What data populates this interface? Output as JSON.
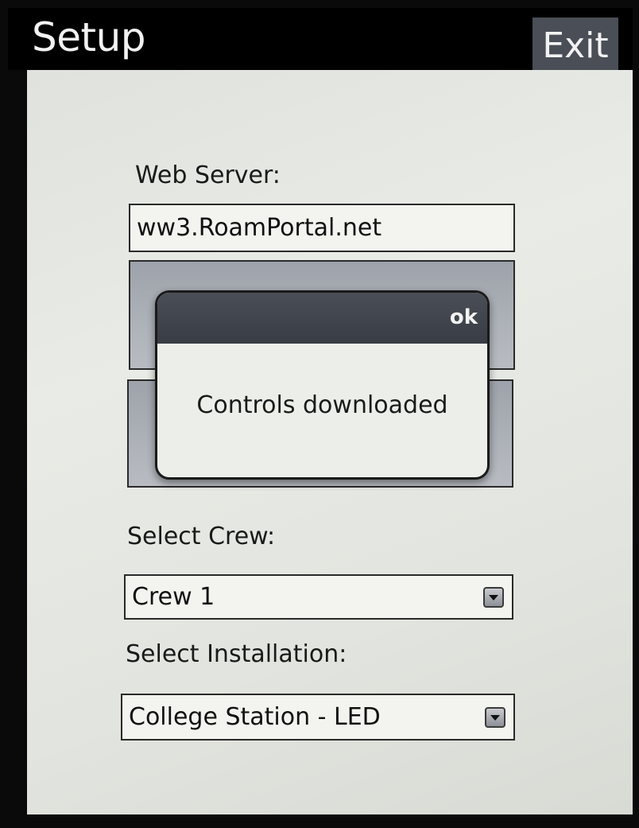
{
  "header": {
    "title": "Setup",
    "exit_label": "Exit"
  },
  "form": {
    "web_server_label": "Web Server:",
    "web_server_value": "ww3.RoamPortal.net",
    "select_crew_label": "Select Crew:",
    "crew_value": "Crew 1",
    "select_installation_label": "Select Installation:",
    "installation_value": "College Station - LED"
  },
  "dialog": {
    "ok_label": "ok",
    "message": "Controls downloaded"
  },
  "colors": {
    "title_bar": "#000000",
    "exit_button": "#4a4e56",
    "content_bg": "#e4e6e1",
    "dialog_header": "#3f434b"
  }
}
